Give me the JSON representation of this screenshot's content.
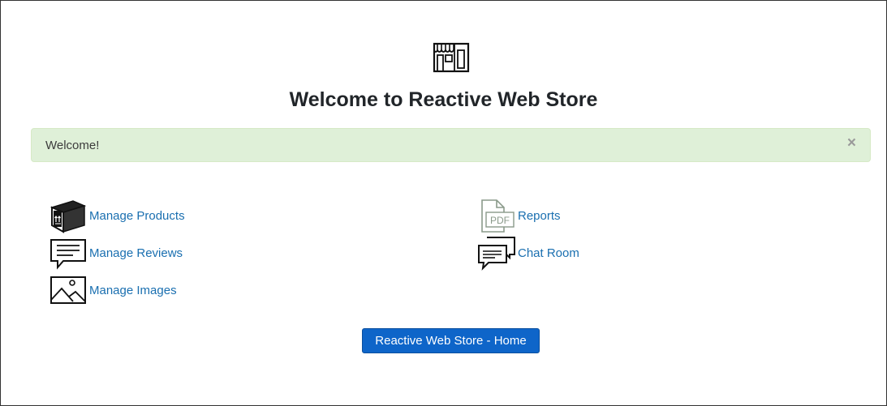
{
  "header": {
    "title": "Welcome to Reactive Web Store",
    "logo_icon": "storefront-icon"
  },
  "alert": {
    "message": "Welcome!",
    "close_label": "×",
    "background_color": "#dff0d8"
  },
  "menu": {
    "left": [
      {
        "label": "Manage Products",
        "icon": "package-box-icon"
      },
      {
        "label": "Manage Reviews",
        "icon": "comment-icon"
      },
      {
        "label": "Manage Images",
        "icon": "image-icon"
      }
    ],
    "right": [
      {
        "label": "Reports",
        "icon": "pdf-file-icon"
      },
      {
        "label": "Chat Room",
        "icon": "chat-bubbles-icon"
      }
    ],
    "link_color": "#1a6fb0"
  },
  "home_button": {
    "label": "Reactive Web Store - Home",
    "color": "#0e65c9"
  }
}
